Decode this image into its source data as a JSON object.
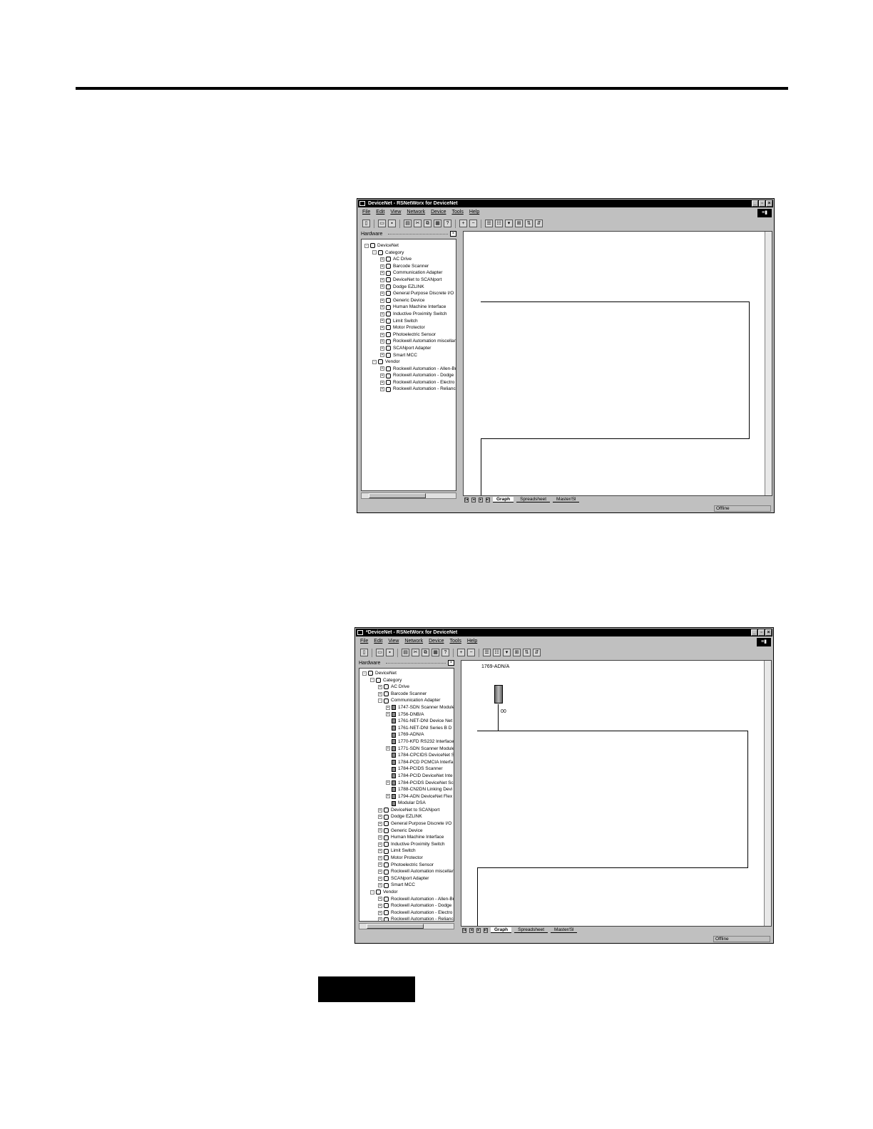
{
  "window_title_1": "DeviceNet - RSNetWorx for DeviceNet",
  "window_title_2": "*DeviceNet - RSNetWorx for DeviceNet",
  "menu": [
    "File",
    "Edit",
    "View",
    "Network",
    "Device",
    "Tools",
    "Help"
  ],
  "hardware_label": "Hardware",
  "tree1": [
    {
      "level": 0,
      "tog": "-",
      "label": "DeviceNet"
    },
    {
      "level": 1,
      "tog": "-",
      "label": "Category"
    },
    {
      "level": 2,
      "tog": "+",
      "label": "AC Drive"
    },
    {
      "level": 2,
      "tog": "+",
      "label": "Barcode Scanner"
    },
    {
      "level": 2,
      "tog": "+",
      "label": "Communication Adapter"
    },
    {
      "level": 2,
      "tog": "+",
      "label": "DeviceNet to SCANport"
    },
    {
      "level": 2,
      "tog": "+",
      "label": "Dodge EZLINK"
    },
    {
      "level": 2,
      "tog": "+",
      "label": "General Purpose Discrete I/O"
    },
    {
      "level": 2,
      "tog": "+",
      "label": "Generic Device"
    },
    {
      "level": 2,
      "tog": "+",
      "label": "Human Machine Interface"
    },
    {
      "level": 2,
      "tog": "+",
      "label": "Inductive Proximity Switch"
    },
    {
      "level": 2,
      "tog": "+",
      "label": "Limit Switch"
    },
    {
      "level": 2,
      "tog": "+",
      "label": "Motor Protector"
    },
    {
      "level": 2,
      "tog": "+",
      "label": "Photoelectric Sensor"
    },
    {
      "level": 2,
      "tog": "+",
      "label": "Rockwell Automation miscellan"
    },
    {
      "level": 2,
      "tog": "+",
      "label": "SCANport Adapter"
    },
    {
      "level": 2,
      "tog": "+",
      "label": "Smart MCC"
    },
    {
      "level": 1,
      "tog": "-",
      "label": "Vendor"
    },
    {
      "level": 2,
      "tog": "+",
      "label": "Rockwell Automation - Allen-Br"
    },
    {
      "level": 2,
      "tog": "+",
      "label": "Rockwell Automation - Dodge"
    },
    {
      "level": 2,
      "tog": "+",
      "label": "Rockwell Automation - Electro"
    },
    {
      "level": 2,
      "tog": "+",
      "label": "Rockwell Automation - Reliance"
    }
  ],
  "tree2": [
    {
      "level": 0,
      "tog": "-",
      "label": "DeviceNet"
    },
    {
      "level": 1,
      "tog": "-",
      "label": "Category"
    },
    {
      "level": 2,
      "tog": "+",
      "label": "AC Drive"
    },
    {
      "level": 2,
      "tog": "+",
      "label": "Barcode Scanner"
    },
    {
      "level": 2,
      "tog": "-",
      "label": "Communication Adapter"
    },
    {
      "level": 3,
      "tog": "+",
      "label": "1747-SDN Scanner Module",
      "dev": true
    },
    {
      "level": 3,
      "tog": "+",
      "label": "1756-DNB/A",
      "dev": true
    },
    {
      "level": 3,
      "tog": "",
      "label": "1761-NET-DNI Device Net",
      "dev": true
    },
    {
      "level": 3,
      "tog": "",
      "label": "1761-NET-DNI Series B D",
      "dev": true
    },
    {
      "level": 3,
      "tog": "",
      "label": "1769-ADN/A",
      "dev": true
    },
    {
      "level": 3,
      "tog": "",
      "label": "1770-KFD RS232 Interface",
      "dev": true
    },
    {
      "level": 3,
      "tog": "+",
      "label": "1771-SDN Scanner Module",
      "dev": true
    },
    {
      "level": 3,
      "tog": "",
      "label": "1784-CPCIDS DeviceNet S",
      "dev": true
    },
    {
      "level": 3,
      "tog": "",
      "label": "1784-PCD PCMCIA Interfa",
      "dev": true
    },
    {
      "level": 3,
      "tog": "",
      "label": "1784-PCIDS Scanner",
      "dev": true
    },
    {
      "level": 3,
      "tog": "",
      "label": "1784-PCID DeviceNet Inte",
      "dev": true
    },
    {
      "level": 3,
      "tog": "+",
      "label": "1784-PCIDS DeviceNet Sc",
      "dev": true
    },
    {
      "level": 3,
      "tog": "",
      "label": "1788-CN2DN Linking Devi",
      "dev": true
    },
    {
      "level": 3,
      "tog": "+",
      "label": "1794-ADN DeviceNet Flex",
      "dev": true
    },
    {
      "level": 3,
      "tog": "",
      "label": "Modular DSA",
      "dev": true
    },
    {
      "level": 2,
      "tog": "+",
      "label": "DeviceNet to SCANport"
    },
    {
      "level": 2,
      "tog": "+",
      "label": "Dodge EZLINK"
    },
    {
      "level": 2,
      "tog": "+",
      "label": "General Purpose Discrete I/O"
    },
    {
      "level": 2,
      "tog": "+",
      "label": "Generic Device"
    },
    {
      "level": 2,
      "tog": "+",
      "label": "Human Machine Interface"
    },
    {
      "level": 2,
      "tog": "+",
      "label": "Inductive Proximity Switch"
    },
    {
      "level": 2,
      "tog": "+",
      "label": "Limit Switch"
    },
    {
      "level": 2,
      "tog": "+",
      "label": "Motor Protector"
    },
    {
      "level": 2,
      "tog": "+",
      "label": "Photoelectric Sensor"
    },
    {
      "level": 2,
      "tog": "+",
      "label": "Rockwell Automation miscellan"
    },
    {
      "level": 2,
      "tog": "+",
      "label": "SCANport Adapter"
    },
    {
      "level": 2,
      "tog": "+",
      "label": "Smart MCC"
    },
    {
      "level": 1,
      "tog": "-",
      "label": "Vendor"
    },
    {
      "level": 2,
      "tog": "+",
      "label": "Rockwell Automation - Allen-Br"
    },
    {
      "level": 2,
      "tog": "+",
      "label": "Rockwell Automation - Dodge"
    },
    {
      "level": 2,
      "tog": "+",
      "label": "Rockwell Automation - Electro"
    },
    {
      "level": 2,
      "tog": "+",
      "label": "Rockwell Automation - Reliance"
    }
  ],
  "tabs": {
    "graph": "Graph",
    "spreadsheet": "Spreadsheet",
    "master": "Master/Sl"
  },
  "status": "Offline",
  "device": {
    "name": "1769-ADN/A",
    "address": "00"
  }
}
